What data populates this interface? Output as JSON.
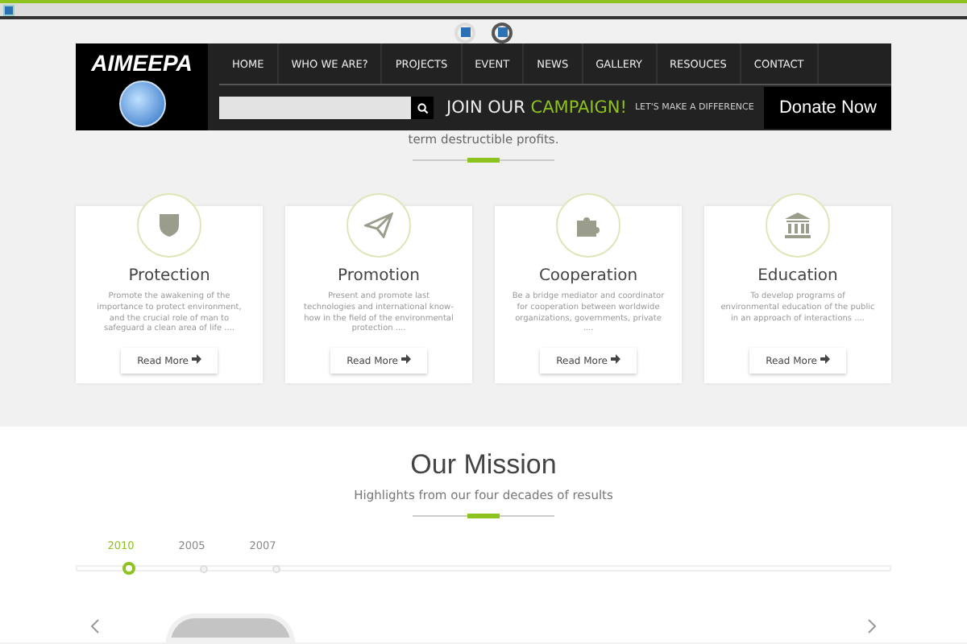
{
  "header": {
    "logo": "AIMEEPA",
    "nav": [
      {
        "label": "HOME",
        "selected": false
      },
      {
        "label": "WHO WE ARE?",
        "selected": false
      },
      {
        "label": "PROJECTS",
        "selected": false
      },
      {
        "label": "EVENT",
        "selected": false
      },
      {
        "label": "NEWS",
        "selected": false
      },
      {
        "label": "GALLERY",
        "selected": false
      },
      {
        "label": "RESOUCES",
        "selected": false
      },
      {
        "label": "CONTACT",
        "selected": false
      }
    ],
    "campaign": {
      "lead": "JOIN OUR",
      "accent": "CAMPAIGN!"
    },
    "tagline": "LET'S MAKE A DIFFERENCE",
    "donate": "Donate Now"
  },
  "intro": "term destructible profits.",
  "objectives": [
    {
      "kind": "shield",
      "title": "Protection",
      "text": "Promote the awakening of the importance to protect environment, and the crucial role of man to safeguard a clean area of life ....",
      "link": "Read More"
    },
    {
      "kind": "plane",
      "title": "Promotion",
      "text": "Present and promote last technologies and international know-how in the field of the environmental protection ....",
      "link": "Read More"
    },
    {
      "kind": "puzzle",
      "title": "Cooperation",
      "text": "Be a bridge mediator and coordinator for cooperation between worldwide organizations, governments, private ....",
      "link": "Read More"
    },
    {
      "kind": "bank",
      "title": "Education",
      "text": "To develop programs of environmental education of the public in an approach of interactions ....",
      "link": "Read More"
    }
  ],
  "mission": {
    "title": "Our Mission",
    "subtitle": "Highlights from our four decades of results",
    "years": [
      {
        "label": "2010",
        "selected": true
      },
      {
        "label": "2005",
        "selected": false
      },
      {
        "label": "2007",
        "selected": false
      }
    ]
  }
}
